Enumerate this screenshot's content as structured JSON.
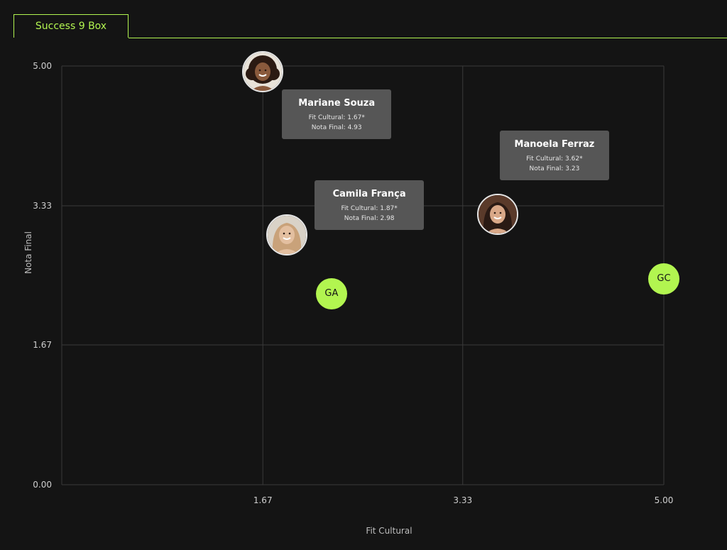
{
  "tab": {
    "label": "Success 9 Box"
  },
  "chart_data": {
    "type": "scatter",
    "xlabel": "Fit Cultural",
    "ylabel": "Nota Final",
    "xlim": [
      0,
      5
    ],
    "ylim": [
      0,
      5
    ],
    "x_ticks": [
      "1.67",
      "3.33",
      "5.00"
    ],
    "y_ticks": [
      "0.00",
      "1.67",
      "3.33",
      "5.00"
    ],
    "grid": true,
    "accent_color": "#b2f550",
    "points": [
      {
        "kind": "avatar",
        "name": "Mariane Souza",
        "x": 1.67,
        "y": 4.93,
        "tooltip": {
          "name": "Mariane Souza",
          "fit_line": "Fit Cultural: 1.67*",
          "nota_line": "Nota Final: 4.93"
        }
      },
      {
        "kind": "avatar",
        "name": "Camila França",
        "x": 1.87,
        "y": 2.98,
        "tooltip": {
          "name": "Camila França",
          "fit_line": "Fit Cultural: 1.87*",
          "nota_line": "Nota Final: 2.98"
        }
      },
      {
        "kind": "avatar",
        "name": "Manoela Ferraz",
        "x": 3.62,
        "y": 3.23,
        "tooltip": {
          "name": "Manoela Ferraz",
          "fit_line": "Fit Cultural: 3.62*",
          "nota_line": "Nota Final: 3.23"
        }
      },
      {
        "kind": "initials",
        "label": "GA",
        "x": 2.24,
        "y": 2.28
      },
      {
        "kind": "initials",
        "label": "GC",
        "x": 5.0,
        "y": 2.46
      }
    ]
  }
}
